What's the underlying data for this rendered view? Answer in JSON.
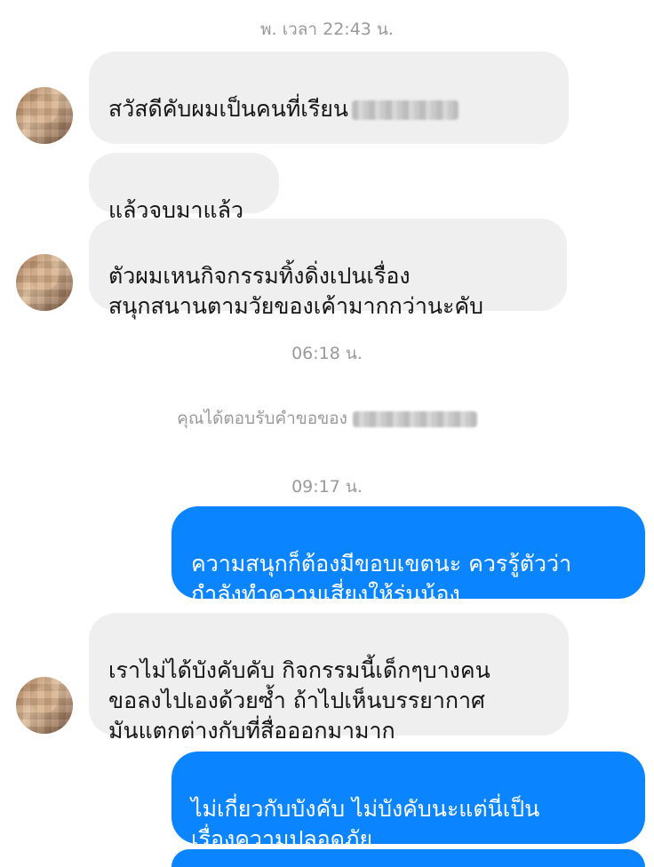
{
  "conversation": {
    "timestamps": {
      "first": "พ. เวลา 22:43 น.",
      "second": "06:18 น.",
      "third": "09:17 น."
    },
    "system_message": "คุณได้ตอบรับคำขอของ",
    "messages": [
      {
        "sender": "other",
        "text": "สวัสดีคับผมเป็นคนที่เรียน"
      },
      {
        "sender": "other",
        "text": "แล้วจบมาแล้ว"
      },
      {
        "sender": "other",
        "text": "ตัวผมเหนกิจกรรมทิ้งดิ่งเปนเรื่อง\nสนุกสนานตามวัยของเค้ามากกว่านะคับ"
      },
      {
        "sender": "me",
        "text": "ความสนุกก็ต้องมีขอบเขตนะ ควรรู้ตัวว่า\nกำลังทำความเสี่ยงให้รุ่นน้อง"
      },
      {
        "sender": "other",
        "text": "เราไม่ได้บังคับคับ กิจกรรมนี้เด็กๆบางคน\nขอลงไปเองด้วยซ้ำ ถ้าไปเห็นบรรยากาศ\nมันแตกต่างกับที่สื่อออกมามาก"
      },
      {
        "sender": "me",
        "text": "ไม่เกี่ยวกับบังคับ ไม่บังคับนะแต่นี่เป็น\nเรื่องความปลอดภัย"
      }
    ]
  },
  "colors": {
    "incoming_bubble": "#efefef",
    "outgoing_bubble": "#0b85ff",
    "timestamp_text": "#9a9a9a"
  }
}
